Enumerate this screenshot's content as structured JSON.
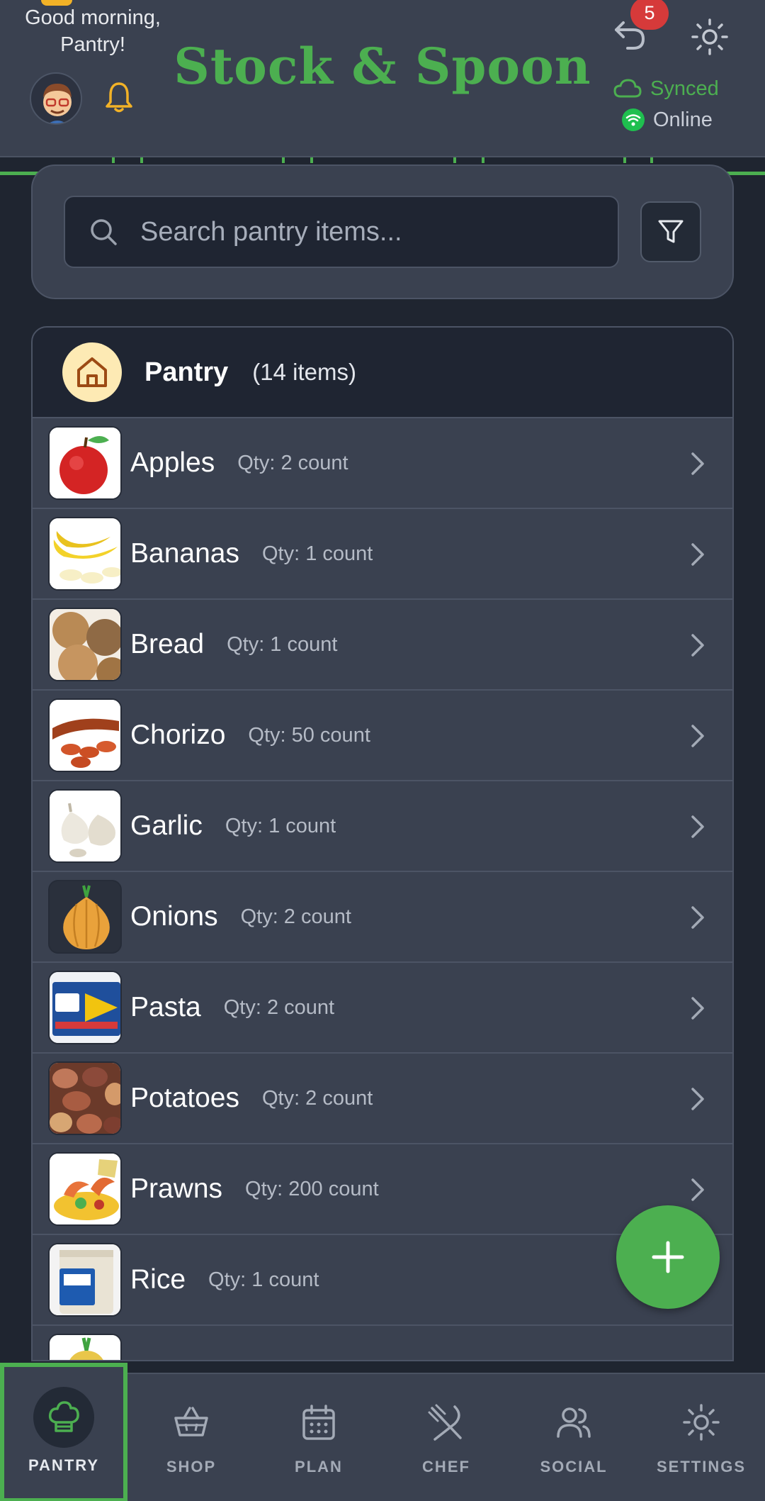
{
  "header": {
    "greeting": "Good morning, Pantry!",
    "app_title": "Stock & Spoon",
    "undo_count": "5",
    "sync_status": "Synced",
    "connection_status": "Online",
    "icons": [
      "avatar",
      "bell-icon",
      "undo-icon",
      "sun-icon",
      "cloud-icon",
      "wifi-icon"
    ]
  },
  "search": {
    "placeholder": "Search pantry items..."
  },
  "pantry": {
    "title": "Pantry",
    "count": "(14 items)",
    "items": [
      {
        "name": "Apples",
        "qty": "Qty: 2 count"
      },
      {
        "name": "Bananas",
        "qty": "Qty: 1 count"
      },
      {
        "name": "Bread",
        "qty": "Qty: 1 count"
      },
      {
        "name": "Chorizo",
        "qty": "Qty: 50 count"
      },
      {
        "name": "Garlic",
        "qty": "Qty: 1 count"
      },
      {
        "name": "Onions",
        "qty": "Qty: 2 count"
      },
      {
        "name": "Pasta",
        "qty": "Qty: 2 count"
      },
      {
        "name": "Potatoes",
        "qty": "Qty: 2 count"
      },
      {
        "name": "Prawns",
        "qty": "Qty: 200 count"
      },
      {
        "name": "Rice",
        "qty": "Qty: 1 count"
      }
    ]
  },
  "nav": {
    "items": [
      {
        "label": "PANTRY",
        "icon": "chef-hat-icon",
        "active": true
      },
      {
        "label": "SHOP",
        "icon": "basket-icon"
      },
      {
        "label": "PLAN",
        "icon": "calendar-icon"
      },
      {
        "label": "CHEF",
        "icon": "utensils-icon"
      },
      {
        "label": "SOCIAL",
        "icon": "users-icon"
      },
      {
        "label": "SETTINGS",
        "icon": "gear-icon"
      }
    ]
  },
  "colors": {
    "accent": "#4caf50",
    "header_bg": "#3a4150",
    "page_bg": "#1f2530",
    "badge": "#d63a3a",
    "bell": "#f2b227"
  }
}
